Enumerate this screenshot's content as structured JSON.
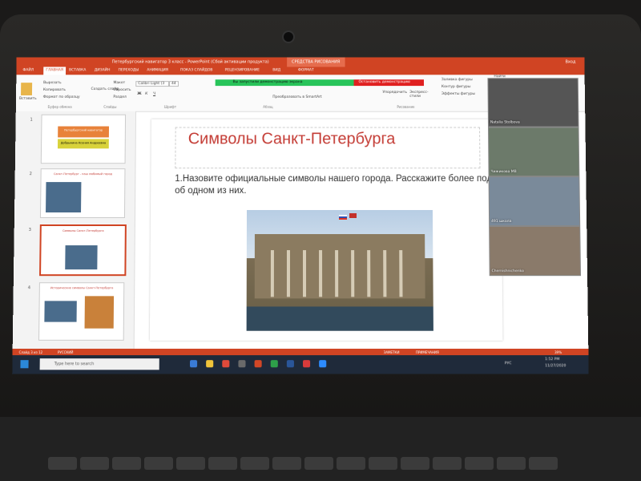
{
  "window": {
    "title": "Петербургский навигатор 3 класс - PowerPoint (Сбой активации продукта)",
    "contextual_tab": "СРЕДСТВА РИСОВАНИЯ",
    "format_tab": "ФОРМАТ",
    "right_corner": "Вход"
  },
  "ribbon_tabs": [
    "ФАЙЛ",
    "ГЛАВНАЯ",
    "ВСТАВКА",
    "ДИЗАЙН",
    "ПЕРЕХОДЫ",
    "АНИМАЦИЯ",
    "ПОКАЗ СЛАЙДОВ",
    "РЕЦЕНЗИРОВАНИЕ",
    "ВИД"
  ],
  "ribbon": {
    "cut": "Вырезать",
    "copy": "Копировать",
    "format_painter": "Формат по образцу",
    "paste": "Вставить",
    "new_slide": "Создать слайд",
    "layout": "Макет",
    "reset": "Сбросить",
    "section": "Раздел",
    "font_name": "Calibri Light (З",
    "font_size": "44",
    "convert_smartart": "Преобразовать в SmartArt",
    "arrange": "Упорядочить",
    "quick_styles": "Экспресс-стили",
    "shape_fill": "Заливка фигуры",
    "shape_outline": "Контур фигуры",
    "shape_effects": "Эффекты фигуры",
    "find": "Найти",
    "group_clipboard": "Буфер обмена",
    "group_slides": "Слайды",
    "group_font": "Шрифт",
    "group_paragraph": "Абзац",
    "group_drawing": "Рисование"
  },
  "screen_share": {
    "banner": "Вы запустили демонстрацию экрана",
    "stop_button": "Остановить демонстрацию"
  },
  "thumbnails": [
    {
      "num": "1",
      "title": "Петербургский навигатор",
      "subtitle": "Добрынина Ксения Андреевна"
    },
    {
      "num": "2",
      "title": "Санкт-Петербург - наш любимый город"
    },
    {
      "num": "3",
      "title": "Символы Санкт-Петербурга"
    },
    {
      "num": "4",
      "title": "Исторические символы Санкт-Петербурга"
    }
  ],
  "slide": {
    "title": "Символы Санкт-Петербурга",
    "body": "1.Назовите официальные символы нашего города.  Расскажите более подробно об одном из них."
  },
  "participants": [
    {
      "name": "Natalia Stolbova"
    },
    {
      "name": "Чижикова МВ"
    },
    {
      "name": "491 школа"
    },
    {
      "name": "Chernishnichenko"
    }
  ],
  "statusbar": {
    "slide_info": "Слайд 3 из 12",
    "language": "РУССКИЙ",
    "notes": "ЗАМЕТКИ",
    "comments": "ПРИМЕЧАНИЯ",
    "zoom": "39%"
  },
  "taskbar": {
    "search_placeholder": "Type here to search",
    "lang": "РУС",
    "time": "1:52 PM",
    "date": "11/27/2020"
  }
}
